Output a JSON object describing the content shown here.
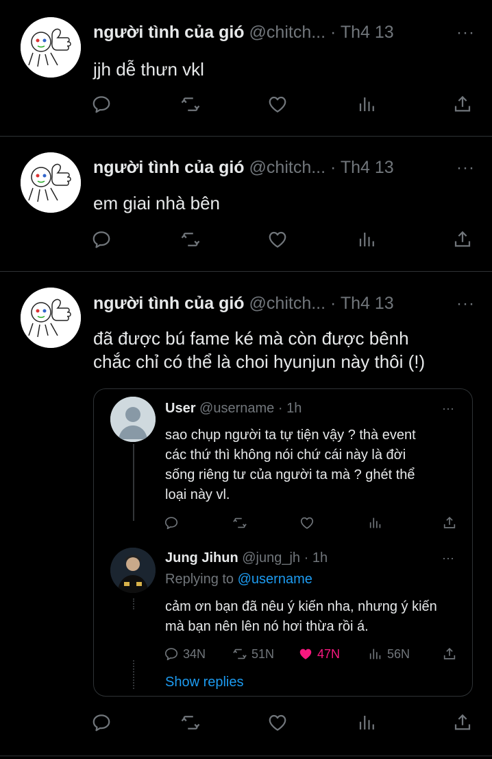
{
  "tweets": [
    {
      "name": "người tình của gió",
      "handle": "@chitch...",
      "time": "· Th4 13",
      "text": [
        "jjh dễ thưn vkl"
      ]
    },
    {
      "name": "người tình của gió",
      "handle": "@chitch...",
      "time": "· Th4 13",
      "text": [
        "em giai nhà bên"
      ]
    },
    {
      "name": "người tình của gió",
      "handle": "@chitch...",
      "time": "· Th4 13",
      "text": [
        "đã được bú fame ké mà còn được bênh",
        "chắc chỉ có thể là choi hyunjun này thôi (!)"
      ]
    }
  ],
  "more_glyph": "···",
  "quote": {
    "reply1": {
      "name": "User",
      "handle": "@username",
      "time": "· 1h",
      "text": [
        "sao chụp người ta tự tiện vậy ? thà event",
        "các thứ thì không nói chứ cái này là đời",
        "sống riêng tư của người ta mà ? ghét thể",
        "loại này vl."
      ]
    },
    "reply2": {
      "name": "Jung Jihun",
      "handle": "@jung_jh",
      "time": "· 1h",
      "replying_prefix": "Replying to",
      "replying_to": "@username",
      "text": [
        "cảm ơn bạn đã nêu ý kiến nha, nhưng ý kiến",
        "mà bạn nên lên nó hơi thừa rồi á."
      ],
      "replies": "34N",
      "retweets": "51N",
      "likes": "47N",
      "views": "56N"
    },
    "show_replies": "Show replies"
  },
  "colors": {
    "background": "#000000",
    "text": "#e7e9ea",
    "muted": "#71767b",
    "link": "#1d9bf0",
    "like": "#f91880"
  },
  "icons": [
    "reply-icon",
    "retweet-icon",
    "like-icon",
    "views-icon",
    "share-icon",
    "more-icon"
  ]
}
